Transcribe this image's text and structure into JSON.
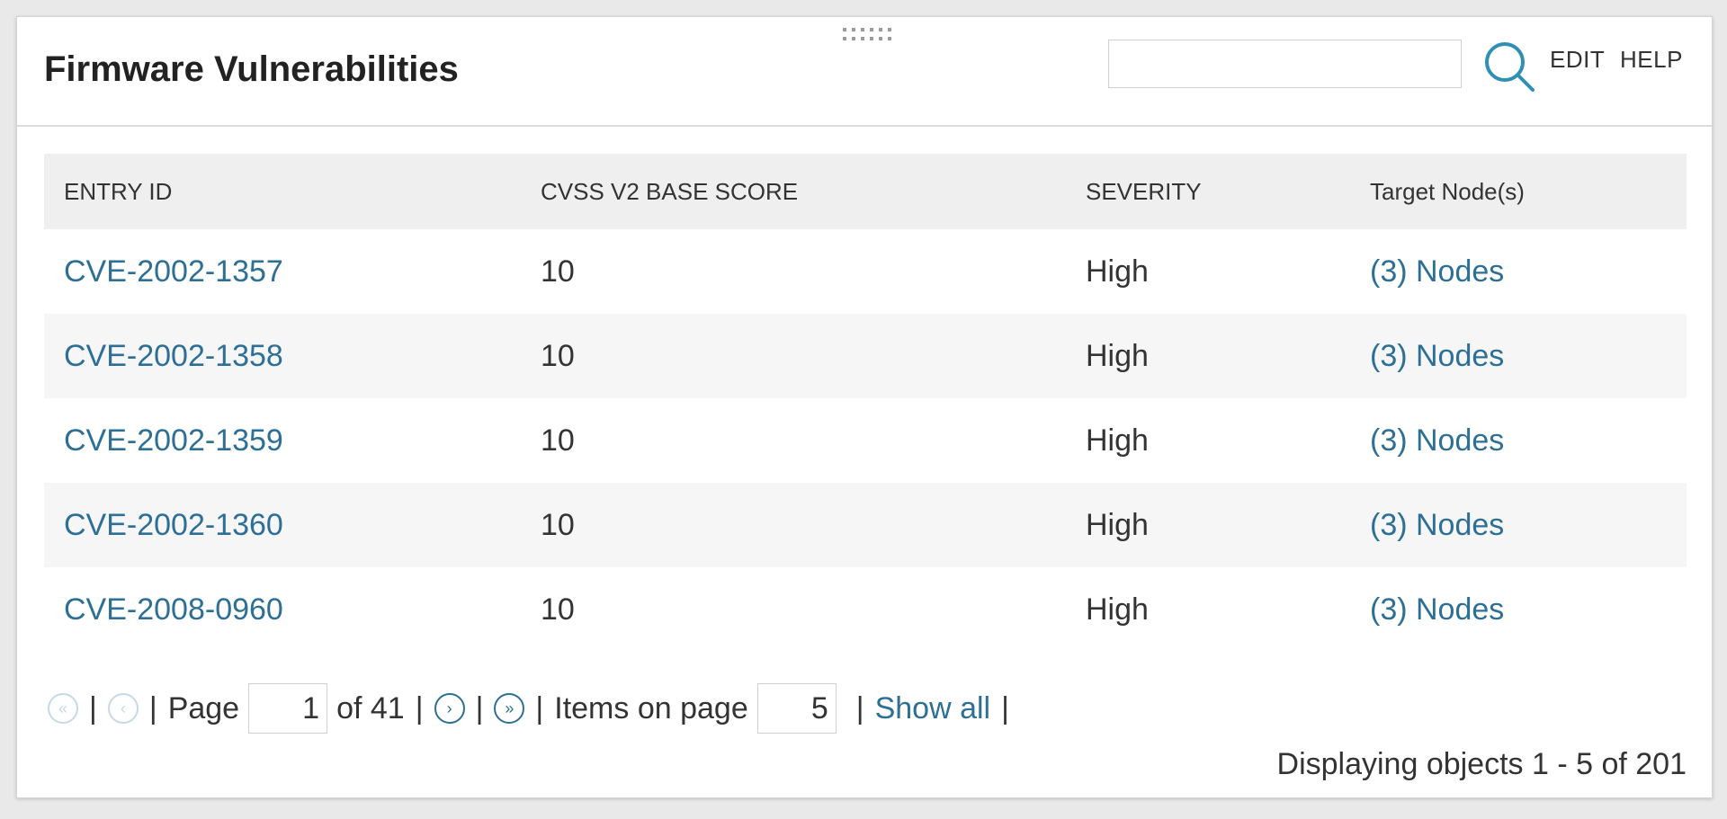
{
  "widget": {
    "title": "Firmware Vulnerabilities",
    "search": {
      "value": "",
      "placeholder": ""
    },
    "edit_label": "EDIT",
    "help_label": "HELP"
  },
  "table": {
    "columns": [
      "ENTRY ID",
      "CVSS V2 BASE SCORE",
      "SEVERITY",
      "Target Node(s)"
    ],
    "rows": [
      {
        "entry_id": "CVE-2002-1357",
        "score": "10",
        "severity": "High",
        "targets": "(3) Nodes"
      },
      {
        "entry_id": "CVE-2002-1358",
        "score": "10",
        "severity": "High",
        "targets": "(3) Nodes"
      },
      {
        "entry_id": "CVE-2002-1359",
        "score": "10",
        "severity": "High",
        "targets": "(3) Nodes"
      },
      {
        "entry_id": "CVE-2002-1360",
        "score": "10",
        "severity": "High",
        "targets": "(3) Nodes"
      },
      {
        "entry_id": "CVE-2008-0960",
        "score": "10",
        "severity": "High",
        "targets": "(3) Nodes"
      }
    ]
  },
  "pager": {
    "page_label": "Page",
    "current_page": "1",
    "of_label": "of 41",
    "items_label": "Items on page",
    "items_per_page": "5",
    "show_all_label": "Show all",
    "separator": "|",
    "summary": "Displaying objects 1 - 5 of 201"
  },
  "colors": {
    "link": "#2d6f95",
    "header_bg": "#efefef",
    "alt_row_bg": "#f6f6f6",
    "page_bg": "#e9e9e9"
  },
  "icons": {
    "search": "search-icon",
    "first": "double-chevron-left-icon",
    "prev": "chevron-left-icon",
    "next": "chevron-right-icon",
    "last": "double-chevron-right-icon",
    "drag": "drag-handle-icon"
  }
}
